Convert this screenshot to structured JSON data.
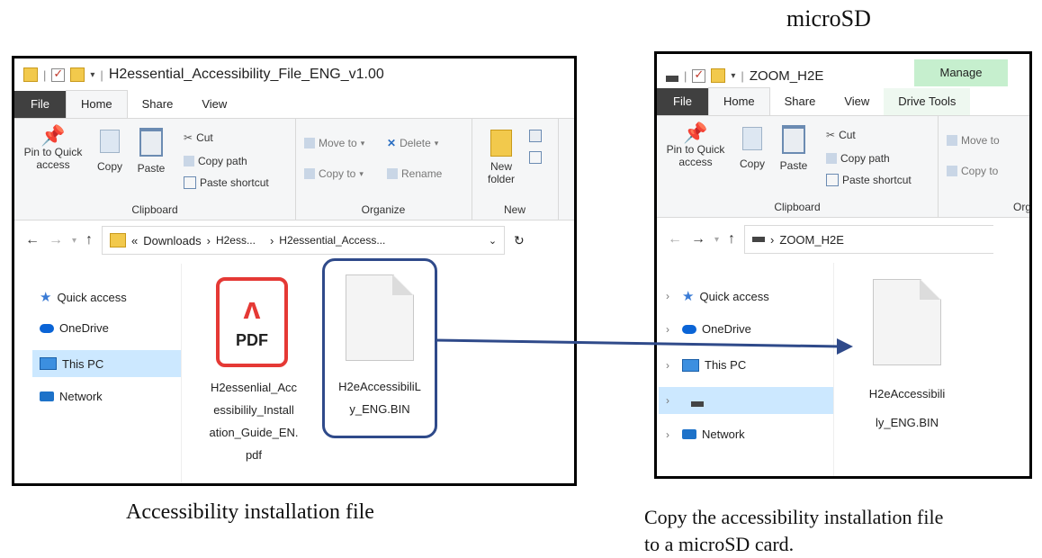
{
  "header": {
    "microsd_label": "microSD"
  },
  "left_window": {
    "title": "H2essential_Accessibility_File_ENG_v1.00",
    "tabs": [
      "File",
      "Home",
      "Share",
      "View"
    ],
    "ribbon": {
      "pin_label_1": "Pin to Quick",
      "pin_label_2": "access",
      "copy": "Copy",
      "paste": "Paste",
      "cut": "Cut",
      "copy_path": "Copy path",
      "paste_shortcut": "Paste shortcut",
      "clipboard_group": "Clipboard",
      "move_to": "Move to",
      "copy_to": "Copy to",
      "delete": "Delete",
      "rename": "Rename",
      "organize_group": "Organize",
      "new_folder_1": "New",
      "new_folder_2": "folder",
      "new_group": "New"
    },
    "address": {
      "prefix": "«",
      "seg1": "Downloads",
      "seg2": "H2ess...",
      "seg3": "H2essential_Access..."
    },
    "nav": [
      "Quick access",
      "OneDrive",
      "This PC",
      "Network"
    ],
    "files": {
      "pdf_icon_text": "PDF",
      "pdf_name_lines": [
        "H2essenlial_Acc",
        "essibilily_Install",
        "ation_Guide_EN.",
        "pdf"
      ],
      "bin_name_lines": [
        "H2eAccessibiliL",
        "y_ENG.BIN"
      ]
    }
  },
  "right_window": {
    "title": "ZOOM_H2E",
    "manage_tab": "Manage",
    "tabs": [
      "File",
      "Home",
      "Share",
      "View",
      "Drive Tools"
    ],
    "ribbon": {
      "pin_label_1": "Pin to Quick",
      "pin_label_2": "access",
      "copy": "Copy",
      "paste": "Paste",
      "cut": "Cut",
      "copy_path": "Copy path",
      "paste_shortcut": "Paste shortcut",
      "clipboard_group": "Clipboard",
      "move_to": "Move to",
      "copy_to": "Copy to",
      "organize_group": "Org"
    },
    "address": {
      "seg1": "ZOOM_H2E"
    },
    "nav": [
      "Quick access",
      "OneDrive",
      "This PC",
      "",
      "Network"
    ],
    "files": {
      "bin_name_lines": [
        "H2eAccessibili",
        "ly_ENG.BIN"
      ]
    }
  },
  "captions": {
    "left": "Accessibility installation file",
    "right_line1": "Copy the accessibility installation file",
    "right_line2": "to a microSD card."
  },
  "colors": {
    "arrow": "#2f4a8a",
    "pdf_red": "#e53935",
    "manage_green": "#c6efce",
    "selection": "#cce8ff"
  }
}
